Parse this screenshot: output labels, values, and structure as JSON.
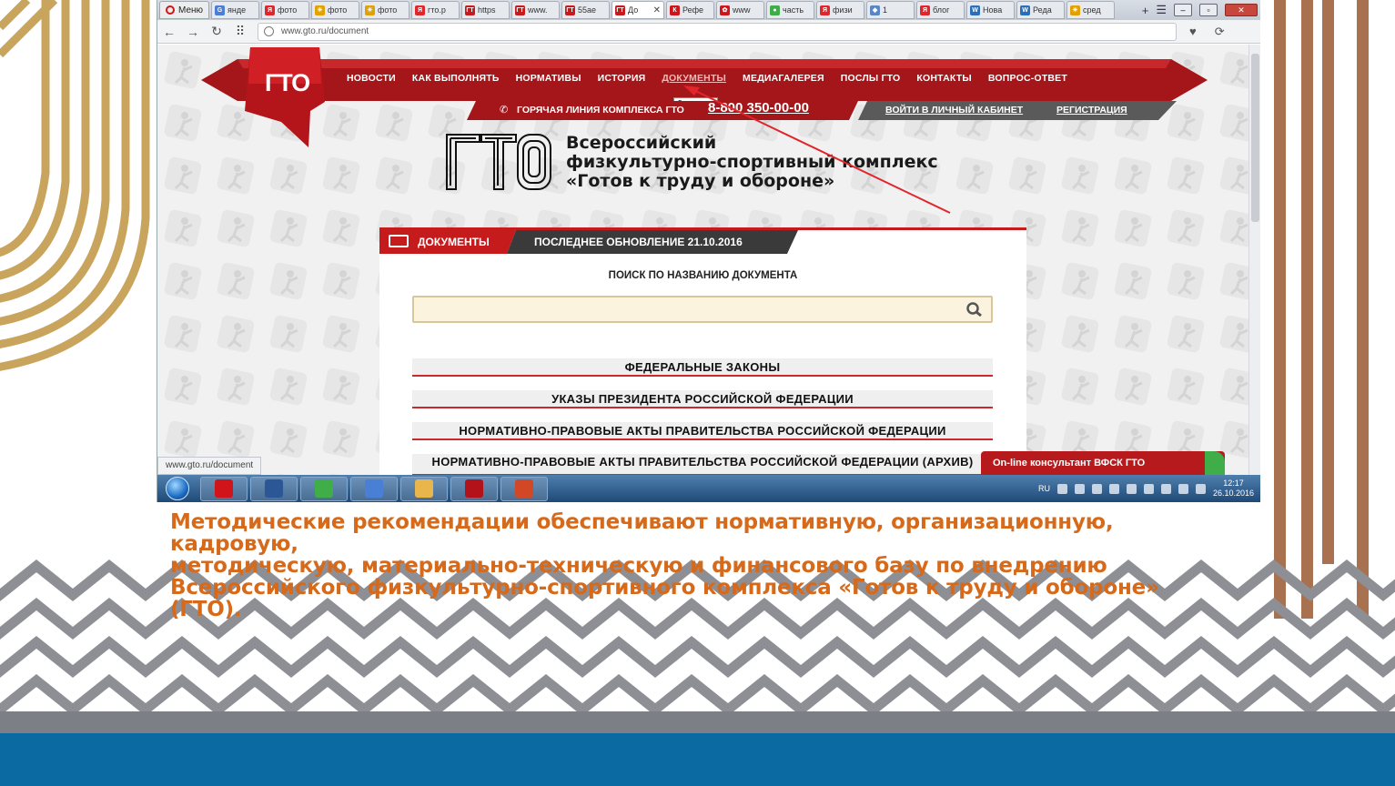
{
  "slide": {
    "caption_lines": [
      "Методические рекомендации обеспечивают нормативную, организационную, кадровую,",
      "методическую, материально-техническую и финансового базу по внедрению",
      "Всероссийского физкультурно-спортивного комплекса «Готов к труду и обороне» (ГТО)."
    ],
    "colors": {
      "caption": "#d76a1a",
      "blue_band": "#0b6aa2",
      "gold_arcs": "#c9a45c",
      "brown_stripes": "#a8714f"
    }
  },
  "browser": {
    "menu_label": "Меню",
    "tabs": [
      {
        "label": "янде",
        "favicon": "G",
        "color": "#4a7fd6"
      },
      {
        "label": "фото",
        "favicon": "Я",
        "color": "#e0262b"
      },
      {
        "label": "фото",
        "favicon": "☀",
        "color": "#e1a100"
      },
      {
        "label": "фото",
        "favicon": "☀",
        "color": "#e1a100"
      },
      {
        "label": "гто.р",
        "favicon": "Я",
        "color": "#e0262b"
      },
      {
        "label": "https",
        "favicon": "ГТ",
        "color": "#c61b1d"
      },
      {
        "label": "www.",
        "favicon": "ГТ",
        "color": "#c61b1d"
      },
      {
        "label": "55ae",
        "favicon": "ГТ",
        "color": "#c61b1d"
      },
      {
        "label": "До",
        "favicon": "ГТ",
        "color": "#c61b1d",
        "active": true
      },
      {
        "label": "Рефе",
        "favicon": "К",
        "color": "#d0141a"
      },
      {
        "label": "www",
        "favicon": "✿",
        "color": "#d0141a"
      },
      {
        "label": "часть",
        "favicon": "●",
        "color": "#3fae49"
      },
      {
        "label": "физи",
        "favicon": "Я",
        "color": "#e0262b"
      },
      {
        "label": "1",
        "favicon": "◆",
        "color": "#5a86c5"
      },
      {
        "label": "блог",
        "favicon": "Я",
        "color": "#e0262b"
      },
      {
        "label": "Нова",
        "favicon": "W",
        "color": "#2b6fb8"
      },
      {
        "label": "Реда",
        "favicon": "W",
        "color": "#2b6fb8"
      },
      {
        "label": "сред",
        "favicon": "☀",
        "color": "#e1a100"
      }
    ],
    "new_tab": "+",
    "url": "www.gto.ru/document",
    "status_url": "www.gto.ru/document"
  },
  "site": {
    "logo_text": "ГТО",
    "nav": [
      {
        "label": "НОВОСТИ"
      },
      {
        "label": "КАК ВЫПОЛНЯТЬ"
      },
      {
        "label": "НОРМАТИВЫ"
      },
      {
        "label": "ИСТОРИЯ"
      },
      {
        "label": "ДОКУМЕНТЫ",
        "current": true
      },
      {
        "label": "МЕДИАГАЛЕРЕЯ"
      },
      {
        "label": "ПОСЛЫ ГТО"
      },
      {
        "label": "КОНТАКТЫ"
      },
      {
        "label": "ВОПРОС-ОТВЕТ"
      }
    ],
    "tooltip": "Документы",
    "hotline_label": "ГОРЯЧАЯ ЛИНИЯ КОМПЛЕКСА ГТО",
    "hotline_phone": "8-800 350-00-00",
    "login_link": "ВОЙТИ В ЛИЧНЫЙ КАБИНЕТ",
    "register_link": "РЕГИСТРАЦИЯ",
    "big_logo_text": "ГТО",
    "complex_title": [
      "Всероссийский",
      "физкультурно-спортивный комплекс",
      "«Готов к труду и обороне»"
    ],
    "documents": {
      "title": "ДОКУМЕНТЫ",
      "last_update": "ПОСЛЕДНЕЕ ОБНОВЛЕНИЕ 21.10.2016",
      "search_label": "ПОИСК ПО НАЗВАНИЮ ДОКУМЕНТА",
      "search_value": "",
      "categories": [
        "ФЕДЕРАЛЬНЫЕ ЗАКОНЫ",
        "УКАЗЫ ПРЕЗИДЕНТА РОССИЙСКОЙ ФЕДЕРАЦИИ",
        "НОРМАТИВНО-ПРАВОВЫЕ АКТЫ ПРАВИТЕЛЬСТВА РОССИЙСКОЙ ФЕДЕРАЦИИ",
        "НОРМАТИВНО-ПРАВОВЫЕ АКТЫ ПРАВИТЕЛЬСТВА РОССИЙСКОЙ ФЕДЕРАЦИИ (АРХИВ)"
      ]
    },
    "consultant": "On-line консультант ВФСК ГТО",
    "colors": {
      "brand_red": "#c61b1d",
      "dark_red": "#8c0f12",
      "grey_band": "#5a5a5a"
    }
  },
  "taskbar": {
    "apps": [
      {
        "name": "opera",
        "color": "#d0141a"
      },
      {
        "name": "word",
        "color": "#2b5797"
      },
      {
        "name": "chrome",
        "color": "#3fae49"
      },
      {
        "name": "network",
        "color": "#4a7fd6"
      },
      {
        "name": "explorer",
        "color": "#e8b64a"
      },
      {
        "name": "acrobat",
        "color": "#b3121a"
      },
      {
        "name": "powerpoint",
        "color": "#d24726"
      }
    ],
    "language": "RU",
    "time": "12:17",
    "date": "26.10.2016"
  }
}
